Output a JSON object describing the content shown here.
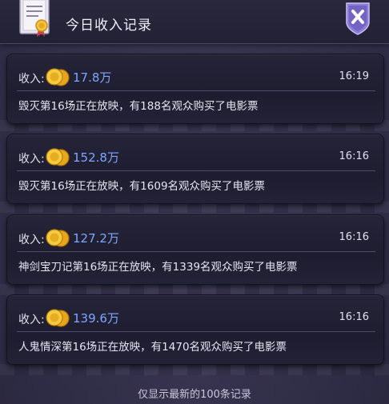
{
  "header": {
    "title": "今日收入记录"
  },
  "records": [
    {
      "label": "收入:",
      "amount": "17.8万",
      "time": "16:19",
      "description": "毁灭第16场正在放映，有188名观众购买了电影票"
    },
    {
      "label": "收入:",
      "amount": "152.8万",
      "time": "16:16",
      "description": "毁灭第16场正在放映，有1609名观众购买了电影票"
    },
    {
      "label": "收入:",
      "amount": "127.2万",
      "time": "16:16",
      "description": "神剑宝刀记第16场正在放映，有1339名观众购买了电影票"
    },
    {
      "label": "收入:",
      "amount": "139.6万",
      "time": "16:16",
      "description": "人鬼情深第16场正在放映，有1470名观众购买了电影票"
    }
  ],
  "footer": {
    "note": "仅显示最新的100条记录"
  },
  "icons": {
    "header": "certificate-icon",
    "close": "close-icon",
    "coin": "coins-icon"
  },
  "colors": {
    "amount": "#7ea6ff",
    "close_shield": "#8d7bd8"
  }
}
